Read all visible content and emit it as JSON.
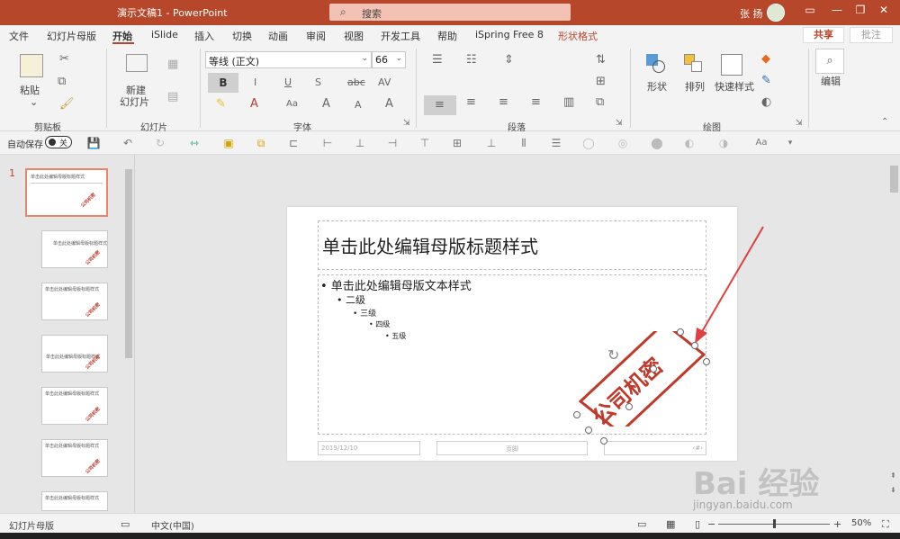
{
  "titlebar": {
    "doc_title": "演示文稿1  -  PowerPoint",
    "search_placeholder": "搜索",
    "user_name": "张 扬",
    "brand_color": "#b7472a"
  },
  "menu": {
    "items": [
      "文件",
      "幻灯片母版",
      "开始",
      "iSlide",
      "插入",
      "切换",
      "动画",
      "审阅",
      "视图",
      "开发工具",
      "帮助",
      "iSpring Free 8",
      "形状格式"
    ],
    "active": "开始",
    "share_label": "共享",
    "comment_label": "批注"
  },
  "ribbon": {
    "paste_label": "粘贴",
    "clipboard_label": "剪贴板",
    "new_slide_label_1": "新建",
    "new_slide_label_2": "幻灯片",
    "slides_label": "幻灯片",
    "font_name": "等线 (正文)",
    "font_size": "66",
    "font_label": "字体",
    "paragraph_label": "段落",
    "shape_label": "形状",
    "arrange_label": "排列",
    "quick_style_label": "快速样式",
    "drawing_label": "绘图",
    "edit_label": "编辑",
    "bold": "B",
    "italic": "I",
    "underline": "U",
    "strike": "S",
    "aa": "Aa",
    "grow": "A^",
    "shrink": "Aˇ",
    "av": "AV"
  },
  "qat": {
    "autosave_label": "自动保存",
    "autosave_state": "关",
    "aa_label": "Aa"
  },
  "thumbnails": {
    "active_number": "1",
    "titles": [
      "单击此处编辑母版标题样式",
      "单击此处编辑母版标题样式",
      "单击此处编辑母版标题样式",
      "单击此处编辑母版标题样式",
      "单击此处编辑母版标题样式",
      "单击此处编辑母版标题样式",
      "单击此处编辑母版标题样式"
    ],
    "stamp_text": "公司机密"
  },
  "slide": {
    "title": "单击此处编辑母版标题样式",
    "levels": [
      "• 单击此处编辑母版文本样式",
      "• 二级",
      "• 三级",
      "• 四级",
      "• 五级"
    ],
    "footer_date": "2019/12/10",
    "footer_center": "页脚",
    "footer_num": "‹#›",
    "stamp_text": "公司机密",
    "stamp_color": "#c0392b"
  },
  "statusbar": {
    "view_label": "幻灯片母版",
    "language": "中文(中国)",
    "zoom": "50%",
    "zoom_percent": 50
  },
  "watermark": {
    "brand": "Bai 经验",
    "url": "jingyan.baidu.com"
  }
}
